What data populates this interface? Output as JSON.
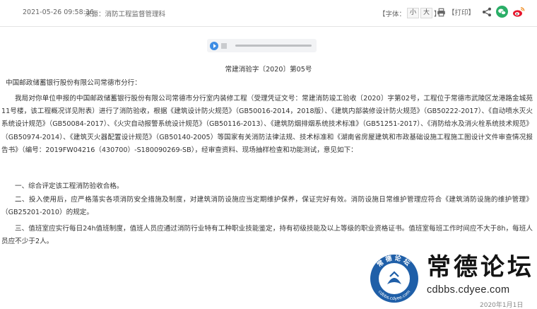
{
  "meta": {
    "date": "2021-05-26 09:58:36",
    "source_label": "来源：消防工程监督管理科"
  },
  "toolbar": {
    "font_label_open": "【字体：",
    "font_small": "小",
    "font_large": "大",
    "font_label_close": "】",
    "print_label": "【打印】"
  },
  "share": {
    "icons": [
      "share-icon",
      "wechat-icon",
      "weibo-icon"
    ],
    "colors": {
      "wechat": "#2aae67",
      "weibo": "#e6162d",
      "share": "#555555"
    }
  },
  "audio": {
    "play_color": "#3d8de4"
  },
  "document": {
    "number": "常建消验字〔2020〕第05号",
    "addressee": "中国邮政储蓄银行股份有限公司常德市分行：",
    "body": "我局对你单位申报的中国邮政储蓄银行股份有限公司常德市分行室内装修工程（受理凭证文号：常建消防竣工验收〔2020〕字第02号，工程位于常德市武陵区龙港路金城苑11号楼，该工程概况详见附表）进行了消防验收，根据《建筑设计防火规范》（GB50016-2014，2018版）、《建筑内部装修设计防火规范》（GB50222-2017）、《自动喷水灭火系统设计规范》（GB50084-2017）、《火灾自动报警系统设计规范》（GB50116-2013）、《建筑防烟排烟系统技术标准》（GB51251-2017）、《消防给水及消火栓系统技术规范》（GB50974-2014）、《建筑灭火器配置设计规范》（GB50140-2005）等国家有关消防法律法规、技术标准和《湖南省房屋建筑和市政基础设施工程施工图设计文件审查情况报告书》（编号：2019FW04216（430700）-S180090269-SB），经审查资料、现场抽样检查和功能测试，意见如下：",
    "items": [
      "一、综合评定该工程消防验收合格。",
      "二、投入使用后，应严格落实各项消防安全措施及制度，对建筑消防设施应当定期维护保养，保证完好有效。消防设施日常维护管理应符合《建筑消防设施的维护管理》（GB25201-2010）的规定。",
      "三、值班室应实行每日24h值班制度，值班人员应通过消防行业特有工种职业技能鉴定，持有初级技能及以上等级的职业资格证书。值班室每班工作时间应不大于8h，每班人员应不少于2人。"
    ],
    "footer_date": "2020年1月1日"
  },
  "watermark": {
    "title": "常德论坛",
    "url": "cdbbs.cdyee.com",
    "logo_ring_text_top": "常德论坛",
    "logo_ring_text_bottom": "cdbbs.cdyee.com",
    "colors": {
      "ring": "#1f5fa8",
      "center": "#ffffff"
    }
  }
}
